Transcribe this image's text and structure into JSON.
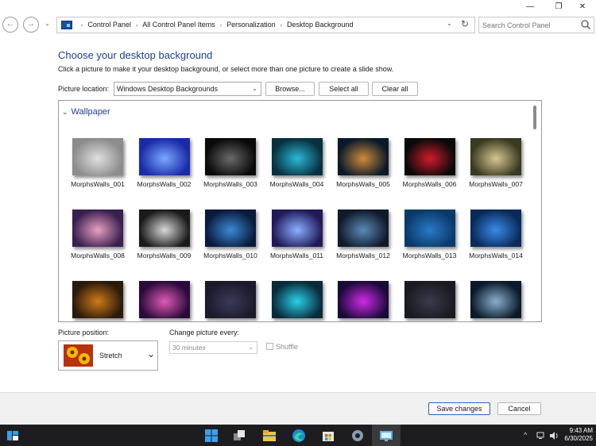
{
  "window": {
    "minimize_glyph": "—",
    "maximize_glyph": "❐",
    "close_glyph": "✕"
  },
  "nav": {
    "back_glyph": "←",
    "forward_glyph": "→",
    "recent_glyph": "⌄",
    "breadcrumbs": [
      "Control Panel",
      "All Control Panel Items",
      "Personalization",
      "Desktop Background"
    ],
    "separator": "›",
    "dropdown_glyph": "⌄",
    "refresh_glyph": "↻"
  },
  "search": {
    "placeholder": "Search Control Panel"
  },
  "main": {
    "heading": "Choose your desktop background",
    "instructions": "Click a picture to make it your desktop background, or select more than one picture to create a slide show.",
    "picture_location_label": "Picture location:",
    "picture_location_value": "Windows Desktop Backgrounds",
    "browse_label": "Browse...",
    "select_all_label": "Select all",
    "clear_all_label": "Clear all"
  },
  "gallery": {
    "group_label": "Wallpaper",
    "group_chevron": "⌄",
    "items": [
      {
        "label": "MorphsWalls_001",
        "bg": "#8c8c8c",
        "fg": "#e0e0e0"
      },
      {
        "label": "MorphsWalls_002",
        "bg": "#1a2aa8",
        "fg": "#7aa8ff"
      },
      {
        "label": "MorphsWalls_003",
        "bg": "#0a0a0a",
        "fg": "#6a6a6a"
      },
      {
        "label": "MorphsWalls_004",
        "bg": "#08303e",
        "fg": "#2bb8d8"
      },
      {
        "label": "MorphsWalls_005",
        "bg": "#0a1a2a",
        "fg": "#d08a3a"
      },
      {
        "label": "MorphsWalls_006",
        "bg": "#0a0a0a",
        "fg": "#d01a2a"
      },
      {
        "label": "MorphsWalls_007",
        "bg": "#3a3a22",
        "fg": "#d8c890"
      },
      {
        "label": "MorphsWalls_008",
        "bg": "#3a2050",
        "fg": "#e8a0c0"
      },
      {
        "label": "MorphsWalls_009",
        "bg": "#1a1a1a",
        "fg": "#d8d8d8"
      },
      {
        "label": "MorphsWalls_010",
        "bg": "#0a1a3a",
        "fg": "#3a8ad8"
      },
      {
        "label": "MorphsWalls_011",
        "bg": "#201a5a",
        "fg": "#8ab0ff"
      },
      {
        "label": "MorphsWalls_012",
        "bg": "#101a2a",
        "fg": "#5a8ab8"
      },
      {
        "label": "MorphsWalls_013",
        "bg": "#0a3a6a",
        "fg": "#2a7ac8"
      },
      {
        "label": "MorphsWalls_014",
        "bg": "#0a2a5a",
        "fg": "#3a8ae8"
      },
      {
        "label": "",
        "bg": "#2a1a0a",
        "fg": "#d07a1a"
      },
      {
        "label": "",
        "bg": "#2a0a3a",
        "fg": "#e05ab8"
      },
      {
        "label": "",
        "bg": "#1a1a2a",
        "fg": "#3a3a5a"
      },
      {
        "label": "",
        "bg": "#082a3a",
        "fg": "#2ad0e8"
      },
      {
        "label": "",
        "bg": "#1a0a3a",
        "fg": "#d02ae8"
      },
      {
        "label": "",
        "bg": "#1a1a22",
        "fg": "#3a3a4a"
      },
      {
        "label": "",
        "bg": "#0a1a2a",
        "fg": "#8ab0d0"
      }
    ]
  },
  "bottom": {
    "picture_position_label": "Picture position:",
    "picture_position_value": "Stretch",
    "position_chevron": "⌄",
    "change_every_label": "Change picture every:",
    "change_every_value": "30 minutes",
    "shuffle_label": "Shuffle"
  },
  "footer": {
    "save_label": "Save changes",
    "cancel_label": "Cancel"
  },
  "taskbar": {
    "tray_chevron": "^",
    "time": "9:43 AM",
    "date": "6/30/2025"
  }
}
